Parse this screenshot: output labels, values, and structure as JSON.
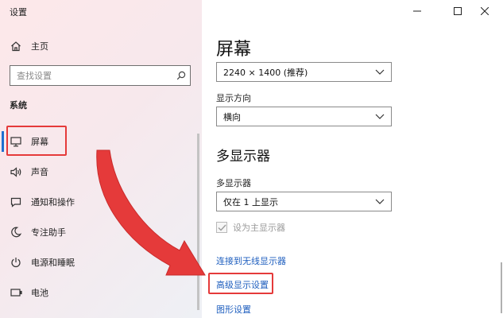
{
  "window": {
    "title": "设置"
  },
  "sidebar": {
    "home_label": "主页",
    "search": {
      "placeholder": "查找设置",
      "value": ""
    },
    "section_title": "系统",
    "items": [
      {
        "label": "屏幕",
        "icon": "monitor-icon",
        "selected": true
      },
      {
        "label": "声音",
        "icon": "speaker-icon",
        "selected": false
      },
      {
        "label": "通知和操作",
        "icon": "notification-icon",
        "selected": false
      },
      {
        "label": "专注助手",
        "icon": "moon-icon",
        "selected": false
      },
      {
        "label": "电源和睡眠",
        "icon": "power-icon",
        "selected": false
      },
      {
        "label": "电池",
        "icon": "battery-icon",
        "selected": false
      }
    ]
  },
  "main": {
    "title": "屏幕",
    "resolution": {
      "value": "2240 × 1400 (推荐)"
    },
    "orientation": {
      "label": "显示方向",
      "value": "横向"
    },
    "multi_display": {
      "heading": "多显示器",
      "label": "多显示器",
      "value": "仅在 1 上显示",
      "checkbox": {
        "label": "设为主显示器",
        "checked": true,
        "disabled": true
      }
    },
    "links": {
      "wireless": "连接到无线显示器",
      "advanced": "高级显示设置",
      "graphics": "图形设置"
    }
  },
  "colors": {
    "accent": "#1f6fd0",
    "link": "#1f5fbf",
    "annotation_red": "#e53a3a"
  }
}
